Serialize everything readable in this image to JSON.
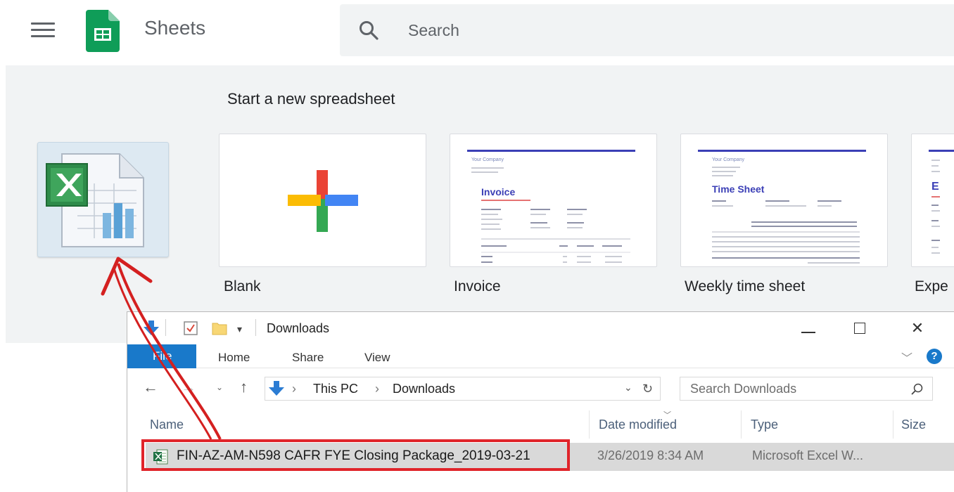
{
  "app": {
    "title": "Sheets",
    "icon": "google-sheets-logo"
  },
  "search": {
    "placeholder": "Search"
  },
  "templates": {
    "section_title": "Start a new spreadsheet",
    "items": [
      {
        "label": "Blank"
      },
      {
        "label": "Invoice",
        "preview": {
          "company": "Your Company",
          "heading": "Invoice"
        }
      },
      {
        "label": "Weekly time sheet",
        "preview": {
          "company": "Your Company",
          "heading": "Time Sheet"
        }
      },
      {
        "label": "Expe",
        "preview": {
          "heading": "E"
        }
      }
    ]
  },
  "explorer": {
    "title": "Downloads",
    "ribbon_tabs": [
      "File",
      "Home",
      "Share",
      "View"
    ],
    "path": [
      "This PC",
      "Downloads"
    ],
    "search_placeholder": "Search Downloads",
    "columns": [
      "Name",
      "Date modified",
      "Type",
      "Size"
    ],
    "files": [
      {
        "name": "FIN-AZ-AM-N598 CAFR FYE Closing Package_2019-03-21",
        "date_modified": "3/26/2019 8:34 AM",
        "type": "Microsoft Excel W..."
      }
    ]
  },
  "colors": {
    "sheets_green": "#0f9d58",
    "explorer_blue": "#1979ca",
    "highlight_red": "#e0242a",
    "template_band": "#f1f3f4"
  },
  "icons": [
    "menu-icon",
    "search-icon",
    "excel-file-icon",
    "plus-icon",
    "minimize-icon",
    "maximize-icon",
    "close-icon",
    "help-icon",
    "refresh-icon",
    "back-arrow-icon",
    "up-arrow-icon"
  ]
}
